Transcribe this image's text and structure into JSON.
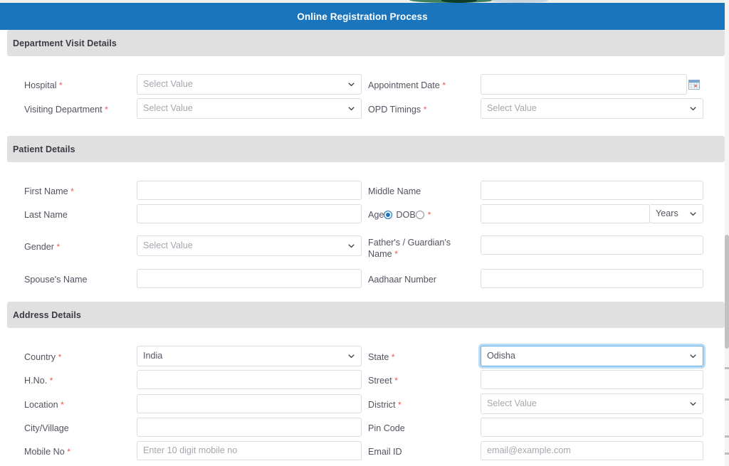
{
  "banner": {
    "title": "Online Registration Process"
  },
  "sections": [
    {
      "id": "department-visit",
      "title": "Department Visit Details"
    },
    {
      "id": "patient",
      "title": "Patient Details"
    },
    {
      "id": "address",
      "title": "Address Details"
    }
  ],
  "placeholders": {
    "select_value": "Select Value",
    "empty": "",
    "mobile": "Enter 10 digit mobile no",
    "email": "email@example.com"
  },
  "fields": {
    "hospital": {
      "label": "Hospital",
      "required": true,
      "type": "select",
      "value": "Select Value"
    },
    "visiting_dept": {
      "label": "Visiting Department",
      "required": true,
      "type": "select",
      "value": "Select Value"
    },
    "appointment_date": {
      "label": "Appointment Date",
      "required": true,
      "type": "text",
      "value": "",
      "icon": "calendar-icon"
    },
    "opd_timings": {
      "label": "OPD Timings",
      "required": true,
      "type": "select",
      "value": "Select Value"
    },
    "first_name": {
      "label": "First Name",
      "required": true,
      "type": "text",
      "value": ""
    },
    "middle_name": {
      "label": "Middle Name",
      "required": false,
      "type": "text",
      "value": ""
    },
    "last_name": {
      "label": "Last Name",
      "required": false,
      "type": "text",
      "value": ""
    },
    "age_dob": {
      "label_age": "Age",
      "label_dob": "DOB",
      "required": true,
      "selected": "Age",
      "value": "",
      "unit": "Years"
    },
    "gender": {
      "label": "Gender",
      "required": true,
      "type": "select",
      "value": "Select Value"
    },
    "father_guardian": {
      "label": "Father's / Guardian's Name",
      "required": true,
      "type": "text",
      "value": ""
    },
    "spouse_name": {
      "label": "Spouse's Name",
      "required": false,
      "type": "text",
      "value": ""
    },
    "aadhaar_number": {
      "label": "Aadhaar Number",
      "required": false,
      "type": "text",
      "value": ""
    },
    "country": {
      "label": "Country",
      "required": true,
      "type": "select",
      "value": "India"
    },
    "state": {
      "label": "State",
      "required": true,
      "type": "select",
      "value": "Odisha",
      "focused": true
    },
    "hno": {
      "label": "H.No.",
      "required": true,
      "type": "text",
      "value": ""
    },
    "street": {
      "label": "Street",
      "required": true,
      "type": "text",
      "value": ""
    },
    "location": {
      "label": "Location",
      "required": true,
      "type": "text",
      "value": ""
    },
    "district": {
      "label": "District",
      "required": true,
      "type": "select",
      "value": "Select Value"
    },
    "city_village": {
      "label": "City/Village",
      "required": false,
      "type": "text",
      "value": ""
    },
    "pin_code": {
      "label": "Pin Code",
      "required": false,
      "type": "text",
      "value": ""
    },
    "mobile_no": {
      "label": "Mobile No",
      "required": true,
      "type": "text",
      "value": "",
      "placeholder": "Enter 10 digit mobile no"
    },
    "email_id": {
      "label": "Email ID",
      "required": false,
      "type": "text",
      "value": "",
      "placeholder": "email@example.com"
    }
  },
  "colors": {
    "banner_blue": "#1b75bc",
    "section_gray": "#e0e0e0",
    "required_red": "#ef5350",
    "label_text": "#53535f",
    "focus_blue": "#66afe9"
  }
}
